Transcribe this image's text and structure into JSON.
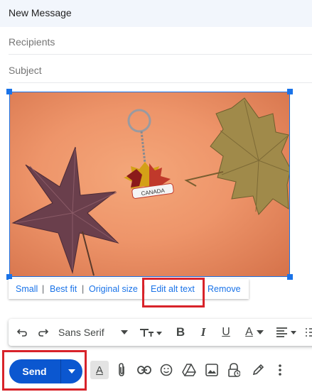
{
  "header": {
    "title": "New Message"
  },
  "recipients": {
    "placeholder": "Recipients"
  },
  "subject": {
    "placeholder": "Subject"
  },
  "image": {
    "description_label": "CANADA"
  },
  "image_menu": {
    "small": "Small",
    "best_fit": "Best fit",
    "original_size": "Original size",
    "edit_alt_text": "Edit alt text",
    "remove": "Remove",
    "separator": "|"
  },
  "format_toolbar": {
    "font": "Sans Serif",
    "bold": "B",
    "italic": "I",
    "underline": "U",
    "text_color": "A"
  },
  "bottom": {
    "send_label": "Send",
    "format_options": "A"
  },
  "colors": {
    "highlight": "#d8232a",
    "send": "#0b57d0",
    "link": "#1a73e8"
  }
}
